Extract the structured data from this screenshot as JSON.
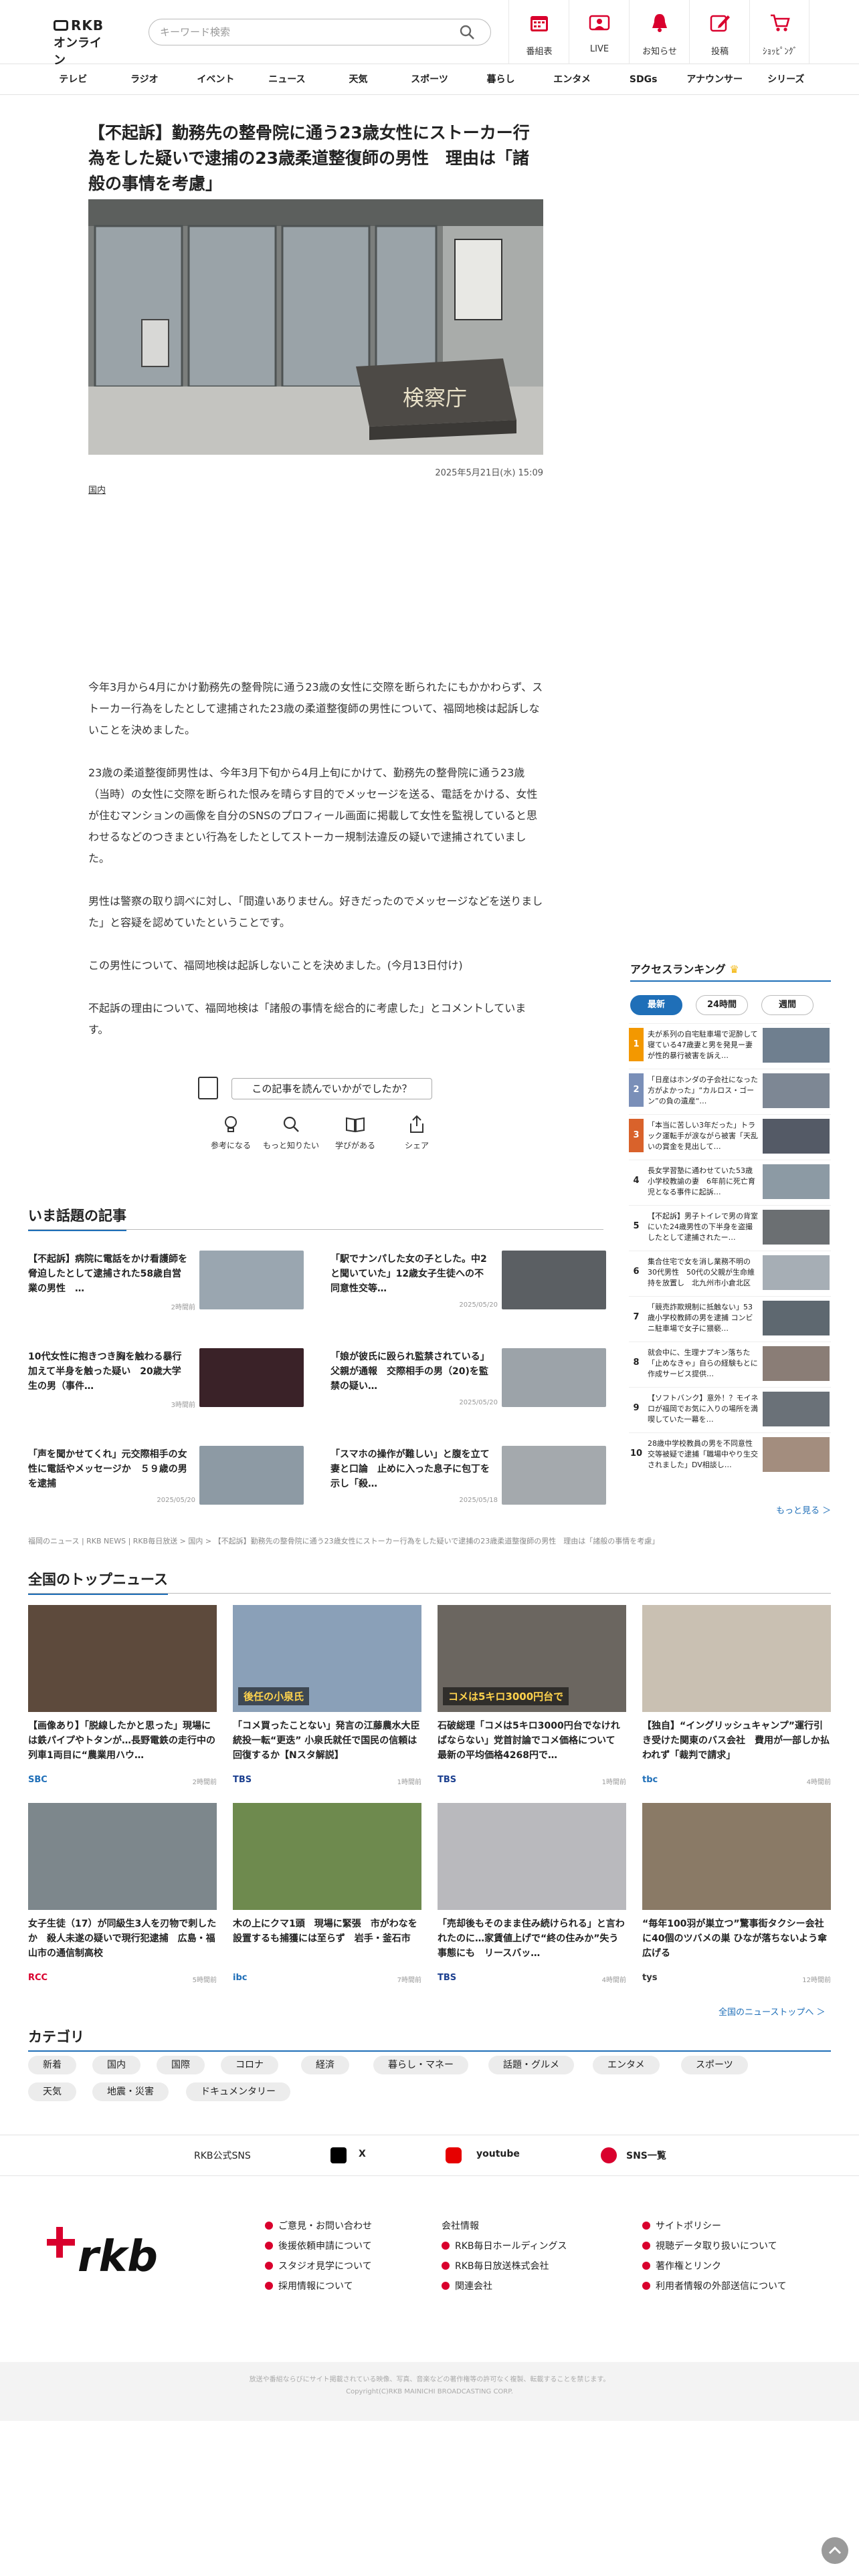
{
  "header": {
    "logo_top": "RKB",
    "logo_bottom": "オンライン",
    "search_placeholder": "キーワード検索",
    "nav": [
      "番組表",
      "LIVE",
      "お知らせ",
      "投稿",
      "ｼｮｯﾋﾟﾝｸﾞ"
    ]
  },
  "global_nav": [
    "テレビ",
    "ラジオ",
    "イベント",
    "ニュース",
    "天気",
    "スポーツ",
    "暮らし",
    "エンタメ",
    "SDGs",
    "アナウンサー",
    "シリーズ"
  ],
  "article": {
    "title": "【不起訴】勤務先の整骨院に通う23歳女性にストーカー行為をした疑いで逮捕の23歳柔道整復師の男性　理由は「諸般の事情を考慮」",
    "hero_sign": "検察庁",
    "date": "2025年5月21日(水) 15:09",
    "category": "国内",
    "paragraphs": [
      "今年3月から4月にかけ勤務先の整骨院に通う23歳の女性に交際を断られたにもかかわらず、ストーカー行為をしたとして逮捕された23歳の柔道整復師の男性について、福岡地検は起訴しないことを決めました。",
      "23歳の柔道整復師男性は、今年3月下旬から4月上旬にかけて、勤務先の整骨院に通う23歳（当時）の女性に交際を断られた恨みを晴らす目的でメッセージを送る、電話をかける、女性が住むマンションの画像を自分のSNSのプロフィール画面に掲載して女性を監視していると思わせるなどのつきまとい行為をしたとしてストーカー規制法違反の疑いで逮捕されていました。",
      "男性は警察の取り調べに対し、「間違いありません。好きだったのでメッセージなどを送りました」と容疑を認めていたということです。",
      "この男性について、福岡地検は起訴しないことを決めました。(今月13日付け)",
      "不起訴の理由について、福岡地検は「諸般の事情を総合的に考慮した」とコメントしています。"
    ],
    "feedback_question": "この記事を読んでいかがでしたか？",
    "reactions": [
      "参考になる",
      "もっと知りたい",
      "学びがある",
      "シェア"
    ]
  },
  "ranking": {
    "title": "アクセスランキング",
    "tabs": [
      "最新",
      "24時間",
      "週間"
    ],
    "items": [
      {
        "rank": "1",
        "title": "夫が系列の自宅駐車場で泥酔して寝ている47歳妻と男を発見ー妻が性的暴行被害を訴え…",
        "color": "#f39800"
      },
      {
        "rank": "2",
        "title": "「日産はホンダの子会社になった方がよかった」“カルロス・ゴーン”の負の遺産“…",
        "color": "#7a8fb8"
      },
      {
        "rank": "3",
        "title": "「本当に苦しい3年だった」トラック運転手が涙ながら被害「天乱いの賞金を見出して…",
        "color": "#d9622b"
      },
      {
        "rank": "4",
        "title": "長女学習塾に通わせていた53歳小学校教諭の妻　6年前に死亡育児となる事件に起訴…",
        "color": ""
      },
      {
        "rank": "5",
        "title": "【不起訴】男子トイレで男の背室にいた24歳男性の下半身を盗撮したとして逮捕されたー…",
        "color": ""
      },
      {
        "rank": "6",
        "title": "集合住宅で女を消し業務不明の30代男性　50代の父親が生命維持を放置し　北九州市小倉北区",
        "color": ""
      },
      {
        "rank": "7",
        "title": "「競売詐欺規制に抵触ない」53歳小学校教師の男を逮捕 コンビニ駐車場で女子に猥褻…",
        "color": ""
      },
      {
        "rank": "8",
        "title": "就会中に、生理ナプキン落ちた「止めなきゃ」自らの経験もとに作成サービス提供…",
        "color": ""
      },
      {
        "rank": "9",
        "title": "【ソフトバンク】意外！？モイネロが福岡でお気に入りの場所を満喫していた一幕を…",
        "color": ""
      },
      {
        "rank": "10",
        "title": "28歳中学校教員の男を不同意性交等被疑で逮捕「職場中やり生交されました」DV相談し…",
        "color": ""
      }
    ],
    "more": "もっと見る ＞"
  },
  "popular": {
    "title": "いま話題の記事",
    "items": [
      {
        "title": "【不起訴】病院に電話をかけ看護師を脅迫したとして逮捕された58歳自営業の男性　…",
        "date": "2時間前"
      },
      {
        "title": "「駅でナンパした女の子とした。中2と聞いていた」12歳女子生徒への不同意性交等…",
        "date": "2025/05/20"
      },
      {
        "title": "10代女性に抱きつき胸を触わる暴行加えて半身を触った疑い　20歳大学生の男（事件…",
        "date": "3時間前"
      },
      {
        "title": "「娘が彼氏に殴られ監禁されている」父親が通報　交際相手の男（20)を監禁の疑い…",
        "date": "2025/05/20"
      },
      {
        "title": "「声を聞かせてくれ」元交際相手の女性に電話やメッセージか　５９歳の男を逮捕",
        "date": "2025/05/20"
      },
      {
        "title": "「スマホの操作が難しい」と腹を立て妻と口論　止めに入った息子に包丁を示し「殺…",
        "date": "2025/05/18"
      }
    ]
  },
  "breadcrumb": "福岡のニュース | RKB NEWS | RKB毎日放送 > 国内 > 【不起訴】勤務先の整骨院に通う23歳女性にストーカー行為をした疑いで逮捕の23歳柔道整復師の男性　理由は「諸般の事情を考慮」",
  "top_news": {
    "title": "全国のトップニュース",
    "items": [
      {
        "title": "【画像あり】「脱線したかと思った」現場には鉄パイプやトタンが…長野電鉄の走行中の列車1両目に“農業用ハウ…",
        "source": "SBC",
        "source_color": "#1f6fb8",
        "date": "2時間前"
      },
      {
        "title": "「コメ買ったことない」発言の江藤農水大臣 統投一転“更迭” 小泉氏就任で国民の信頼は回復するか【Nスタ解説】",
        "source": "TBS",
        "source_color": "#1b3f8f",
        "date": "1時間前",
        "caption": "後任の小泉氏"
      },
      {
        "title": "石破総理「コメは5キロ3000円台でなければならない」党首討論でコメ価格について　最新の平均価格4268円で…",
        "source": "TBS",
        "source_color": "#1b3f8f",
        "date": "1時間前",
        "caption": "コメは5キロ3000円台で"
      },
      {
        "title": "【独自】“イングリッシュキャンプ”運行引き受けた関東のバス会社　費用が一部しか払われず「裁判で請求」",
        "source": "tbc",
        "source_color": "#1f6fb8",
        "date": "4時間前"
      },
      {
        "title": "女子生徒（17）が同級生3人を刃物で刺したか　殺人未遂の疑いで現行犯逮捕　広島・福山市の通信制高校",
        "source": "RCC",
        "source_color": "#d9002d",
        "date": "5時間前"
      },
      {
        "title": "木の上にクマ1頭　現場に緊張　市がわなを設置するも捕獲には至らず　岩手・釜石市",
        "source": "ibc",
        "source_color": "#1f6fb8",
        "date": "7時間前"
      },
      {
        "title": "「売却後もそのまま住み続けられる」と言われたのに…家賃値上げで“終の住みか”失う事態にも　リースバッ…",
        "source": "TBS",
        "source_color": "#1b3f8f",
        "date": "4時間前"
      },
      {
        "title": "“毎年100羽が巣立つ”驚事街タクシー会社に40個のツバメの巣 ひなが落ちないよう傘広げる",
        "source": "tys",
        "source_color": "#333333",
        "date": "12時間前"
      }
    ],
    "more": "全国のニューストップへ ＞"
  },
  "categories": {
    "title": "カテゴリ",
    "items": [
      "新着",
      "国内",
      "国際",
      "コロナ",
      "経済",
      "暮らし・マネー",
      "話題・グルメ",
      "エンタメ",
      "スポーツ",
      "天気",
      "地震・災害",
      "ドキュメンタリー"
    ]
  },
  "sns": {
    "label": "RKB公式SNS",
    "items": [
      "X",
      "youtube",
      "SNS一覧"
    ]
  },
  "footer": {
    "logo": "rkb",
    "col1": [
      "ご意見・お問い合わせ",
      "後援依頼申請について",
      "スタジオ見学について",
      "採用情報について"
    ],
    "col2_title": "会社情報",
    "col2": [
      "RKB毎日ホールディングス",
      "RKB毎日放送株式会社",
      "関連会社"
    ],
    "col3": [
      "サイトポリシー",
      "視聴データ取り扱いについて",
      "著作権とリンク",
      "利用者情報の外部送信について"
    ],
    "copy1": "放送や番組ならびにサイト掲載されている映像、写真、音楽などの著作権等の許可なく複製、転載することを禁じます。",
    "copy2": "Copyright(C)RKB MAINICHI BROADCASTING CORP."
  },
  "colors": {
    "accent": "#1f6fb8",
    "brand_red": "#d9002d"
  }
}
